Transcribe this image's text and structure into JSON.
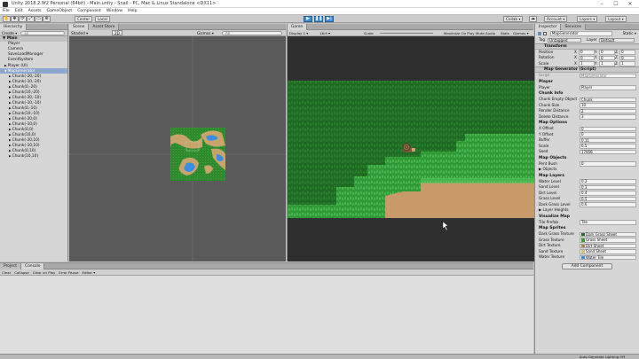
{
  "window": {
    "title": "Unity 2018.2.9f2 Personal (64bit) - Main.unity - Snail - PC, Mac & Linux Standalone <DX11>",
    "minimize": "–",
    "maximize": "☐",
    "close": "✕"
  },
  "menu": [
    "File",
    "Edit",
    "Assets",
    "GameObject",
    "Component",
    "Window",
    "Help"
  ],
  "toolbar": {
    "center": "Center",
    "local": "Local",
    "collab": "Collab ▾",
    "account": "Account ▾",
    "layers": "Layers ▾",
    "layout": "Layout ▾",
    "play": "▶",
    "pause": "❚❚",
    "step": "▶|"
  },
  "hierarchy": {
    "tab": "Hierarchy",
    "create": "Create ▾",
    "search_placeholder": "All",
    "scene": "Main",
    "items": [
      {
        "label": "Player",
        "indent": 1
      },
      {
        "label": "Camera",
        "indent": 1
      },
      {
        "label": "SaveLoadManager",
        "indent": 1
      },
      {
        "label": "EventSystem",
        "indent": 1
      },
      {
        "label": "Player (UI)",
        "indent": 1,
        "arrow": "▶"
      },
      {
        "label": "MapGenerator",
        "indent": 1,
        "arrow": "▼",
        "selected": true
      },
      {
        "label": "Chunk(-20,-20)",
        "indent": 2,
        "arrow": "▶"
      },
      {
        "label": "Chunk(-10,-20)",
        "indent": 2,
        "arrow": "▶"
      },
      {
        "label": "Chunk(0,-20)",
        "indent": 2,
        "arrow": "▶"
      },
      {
        "label": "Chunk(10,-20)",
        "indent": 2,
        "arrow": "▶"
      },
      {
        "label": "Chunk(-20,-10)",
        "indent": 2,
        "arrow": "▶"
      },
      {
        "label": "Chunk(-10,-10)",
        "indent": 2,
        "arrow": "▶"
      },
      {
        "label": "Chunk(0,-10)",
        "indent": 2,
        "arrow": "▶"
      },
      {
        "label": "Chunk(10,-10)",
        "indent": 2,
        "arrow": "▶"
      },
      {
        "label": "Chunk(-20,0)",
        "indent": 2,
        "arrow": "▶"
      },
      {
        "label": "Chunk(-10,0)",
        "indent": 2,
        "arrow": "▶"
      },
      {
        "label": "Chunk(0,0)",
        "indent": 2,
        "arrow": "▶"
      },
      {
        "label": "Chunk(10,0)",
        "indent": 2,
        "arrow": "▶"
      },
      {
        "label": "Chunk(-20,10)",
        "indent": 2,
        "arrow": "▶"
      },
      {
        "label": "Chunk(-10,10)",
        "indent": 2,
        "arrow": "▶"
      },
      {
        "label": "Chunk(0,10)",
        "indent": 2,
        "arrow": "▶"
      },
      {
        "label": "Chunk(10,10)",
        "indent": 2,
        "arrow": "▶"
      }
    ]
  },
  "scene": {
    "tab": "Scene",
    "tab2": "Asset Store",
    "shaded": "Shaded ▾",
    "mode2d": "2D",
    "gizmos": "Gizmos ▾",
    "search_placeholder": "All"
  },
  "game": {
    "tab": "Game",
    "display": "Display 1 ▾",
    "aspect": "16:9 ▾",
    "scale": "Scale",
    "maximize": "Maximize On Play",
    "mute": "Mute Audio",
    "stats": "Stats",
    "gizmos": "Gizmos ▾"
  },
  "inspector": {
    "tab": "Inspector",
    "tab2": "Services",
    "object_name": "MapGenerator",
    "static": "Static ▾",
    "tag_label": "Tag",
    "tag": "Untagged",
    "layer_label": "Layer",
    "layer": "Default",
    "transform": {
      "title": "Transform",
      "position": "Position",
      "rotation": "Rotation",
      "scale": "Scale",
      "x": "X",
      "y": "Y",
      "z": "Z",
      "pos": [
        "0",
        "0",
        "0"
      ],
      "rot": [
        "0",
        "0",
        "0"
      ],
      "scl": [
        "1",
        "1",
        "1"
      ]
    },
    "script": {
      "title": "Map Generator (Script)",
      "script_label": "Script",
      "script_value": "MapGenerator",
      "sections": [
        {
          "title": "Player",
          "fields": [
            {
              "label": "Player",
              "value": "Player"
            }
          ]
        },
        {
          "title": "Chunk Info",
          "fields": [
            {
              "label": "Chunk Empty Object",
              "value": "Chunk"
            },
            {
              "label": "Chunk Size",
              "value": "10"
            },
            {
              "label": "Render Distance",
              "value": "2"
            },
            {
              "label": "Delete Distance",
              "value": "3"
            }
          ]
        },
        {
          "title": "Map Options",
          "fields": [
            {
              "label": "X Offset",
              "value": "0"
            },
            {
              "label": "Y Offset",
              "value": "0"
            },
            {
              "label": "Buffer",
              "value": "0.11"
            },
            {
              "label": "Scale",
              "value": "6.5"
            },
            {
              "label": "Seed",
              "value": "17856"
            }
          ]
        },
        {
          "title": "Map Objects",
          "fields": [
            {
              "label": "Pent Bush",
              "value": "0"
            },
            {
              "label": "▶ Objects",
              "value": ""
            }
          ]
        },
        {
          "title": "Map Layers",
          "fields": [
            {
              "label": "Water Level",
              "value": "0.2"
            },
            {
              "label": "Sand Level",
              "value": "0.3"
            },
            {
              "label": "Dirt Level",
              "value": "0.4"
            },
            {
              "label": "Grass Level",
              "value": "0.5"
            },
            {
              "label": "Dark Grass Level",
              "value": "0.6"
            },
            {
              "label": "▶ Layer Heights",
              "value": ""
            }
          ]
        },
        {
          "title": "Visualize Map",
          "fields": [
            {
              "label": "Tile Prefab",
              "value": "Tile"
            }
          ]
        },
        {
          "title": "Map Sprites",
          "fields": [
            {
              "label": "Dark Grass Texture",
              "value": "Dark Grass Sheet"
            },
            {
              "label": "Grass Texture",
              "value": "Grass Sheet"
            },
            {
              "label": "Dirt Texture",
              "value": "Dirt Sheet"
            },
            {
              "label": "Sand Texture",
              "value": "Sand Sheet"
            },
            {
              "label": "Water Texture",
              "value": "Water Tile"
            }
          ]
        }
      ]
    },
    "add_component": "Add Component"
  },
  "console": {
    "tab": "Project",
    "tab2": "Console",
    "clear": "Clear",
    "collapse": "Collapse",
    "clear_on_play": "Clear on Play",
    "error_pause": "Error Pause",
    "editor": "Editor ▾"
  },
  "status": {
    "text": "Auto Generate Lighting Off"
  },
  "colors": {
    "accent": "#3c8ed8",
    "selection": "#8da8cf",
    "grass": "#2f8a2f",
    "dark_grass": "#1f6a22",
    "dirt": "#c89a6a"
  }
}
